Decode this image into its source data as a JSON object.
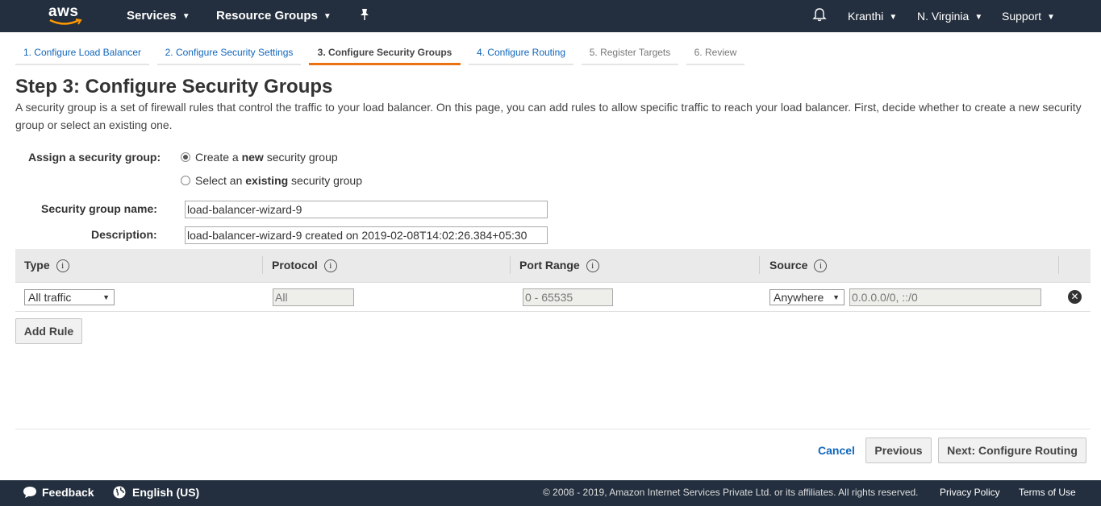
{
  "topnav": {
    "logo_text": "aws",
    "services": "Services",
    "resource_groups": "Resource Groups",
    "user": "Kranthi",
    "region": "N. Virginia",
    "support": "Support"
  },
  "wizard": {
    "tabs": [
      {
        "label": "1. Configure Load Balancer"
      },
      {
        "label": "2. Configure Security Settings"
      },
      {
        "label": "3. Configure Security Groups"
      },
      {
        "label": "4. Configure Routing"
      },
      {
        "label": "5. Register Targets"
      },
      {
        "label": "6. Review"
      }
    ],
    "active_tab": 3
  },
  "page": {
    "title": "Step 3: Configure Security Groups",
    "intro": "A security group is a set of firewall rules that control the traffic to your load balancer. On this page, you can add rules to allow specific traffic to reach your load balancer. First, decide whether to create a new security group or select an existing one."
  },
  "form": {
    "assign_label": "Assign a security group:",
    "option_new_pre": "Create a ",
    "option_new_bold": "new",
    "option_new_post": " security group",
    "option_existing_pre": "Select an ",
    "option_existing_bold": "existing",
    "option_existing_post": " security group",
    "selected_option": "new",
    "name_label": "Security group name:",
    "name_value": "load-balancer-wizard-9",
    "description_label": "Description:",
    "description_value": "load-balancer-wizard-9 created on 2019-02-08T14:02:26.384+05:30"
  },
  "rules": {
    "headers": [
      "Type",
      "Protocol",
      "Port Range",
      "Source"
    ],
    "info_glyph": "i",
    "rows": [
      {
        "type": "All traffic",
        "protocol": "All",
        "port_range": "0 - 65535",
        "source": "Anywhere",
        "cidr": "0.0.0.0/0, ::/0"
      }
    ],
    "add_rule": "Add Rule"
  },
  "actions": {
    "cancel": "Cancel",
    "previous": "Previous",
    "next": "Next: Configure Routing"
  },
  "footer": {
    "feedback": "Feedback",
    "language": "English (US)",
    "copyright": "© 2008 - 2019, Amazon Internet Services Private Ltd. or its affiliates. All rights reserved.",
    "privacy": "Privacy Policy",
    "terms": "Terms of Use"
  },
  "colors": {
    "nav_bg": "#232f3e",
    "accent": "#ec7211",
    "link": "#1166bb"
  }
}
